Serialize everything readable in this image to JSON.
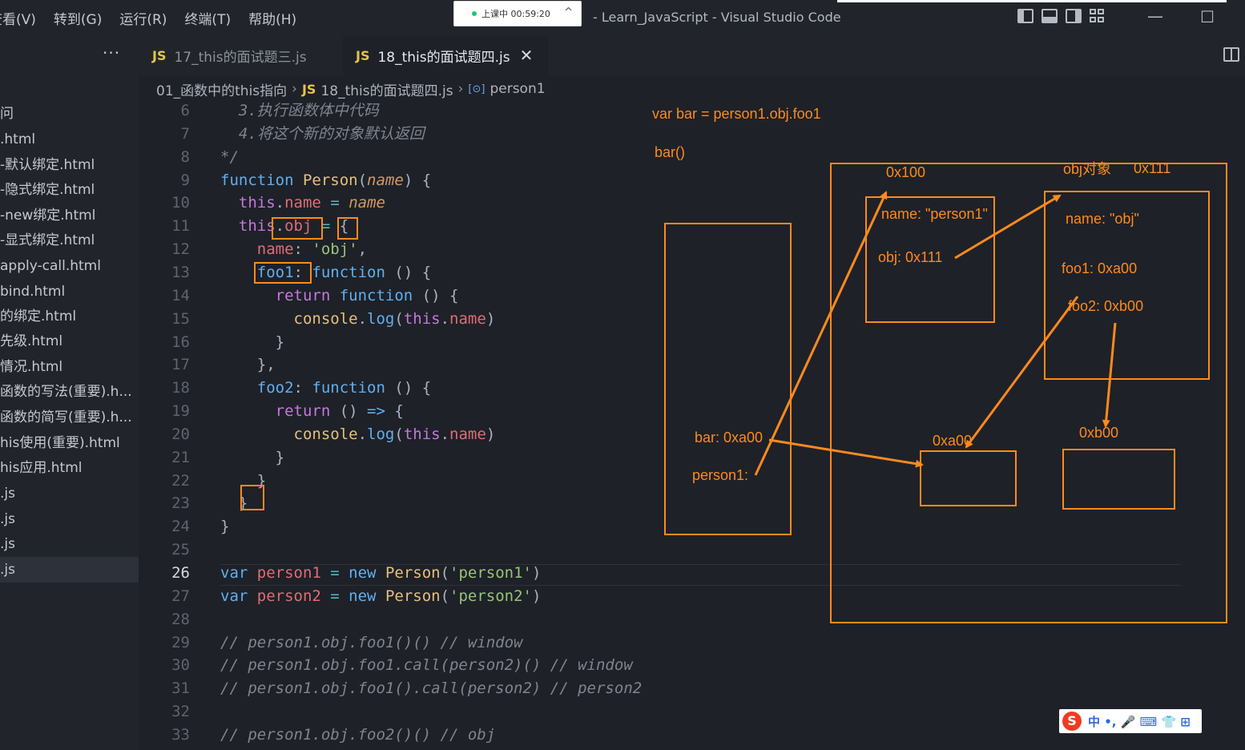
{
  "titlebar": {
    "menu": [
      "查看(V)",
      "转到(G)",
      "运行(R)",
      "终端(T)",
      "帮助(H)"
    ],
    "window_title": "- Learn_JavaScript - Visual Studio Code",
    "recording": "上课中 00:59:20"
  },
  "tabs": {
    "more": "···",
    "inactive": {
      "icon": "JS",
      "label": "17_this的面试题三.js"
    },
    "active": {
      "icon": "JS",
      "label": "18_this的面试题四.js",
      "close": "✕"
    }
  },
  "sidebar": {
    "items": [
      "问",
      ".html",
      "-默认绑定.html",
      "-隐式绑定.html",
      "-new绑定.html",
      "-显式绑定.html",
      "apply-call.html",
      "bind.html",
      "的绑定.html",
      "先级.html",
      "情况.html",
      "函数的写法(重要).h...",
      "函数的简写(重要).h...",
      "his使用(重要).html",
      "his应用.html",
      ".js",
      ".js",
      ".js",
      ".js"
    ]
  },
  "breadcrumb": {
    "folder": "01_函数中的this指向",
    "file_icon": "JS",
    "file": "18_this的面试题四.js",
    "symbol_icon": "[⊙]",
    "symbol": "person1"
  },
  "code": {
    "current_line": 26,
    "lines": [
      {
        "n": "6",
        "tokens": [
          [
            "cm",
            "  3.执行函数体中代码"
          ]
        ]
      },
      {
        "n": "7",
        "tokens": [
          [
            "cm",
            "  4.将这个新的对象默认返回"
          ]
        ]
      },
      {
        "n": "8",
        "tokens": [
          [
            "cm",
            "*/"
          ]
        ]
      },
      {
        "n": "9",
        "tokens": [
          [
            "kwb",
            "function "
          ],
          [
            "fn",
            "Person"
          ],
          [
            "pun",
            "("
          ],
          [
            "par",
            "name"
          ],
          [
            "pun",
            ") {"
          ]
        ]
      },
      {
        "n": "10",
        "tokens": [
          [
            "pun",
            "  "
          ],
          [
            "kw",
            "this"
          ],
          [
            "pun",
            "."
          ],
          [
            "prop",
            "name"
          ],
          [
            "op",
            " = "
          ],
          [
            "par",
            "name"
          ]
        ]
      },
      {
        "n": "11",
        "tokens": [
          [
            "pun",
            "  "
          ],
          [
            "kw",
            "this"
          ],
          [
            "pun",
            "."
          ],
          [
            "prop",
            "obj"
          ],
          [
            "op",
            " = "
          ],
          [
            "pun",
            "{"
          ]
        ]
      },
      {
        "n": "12",
        "tokens": [
          [
            "pun",
            "    "
          ],
          [
            "prop",
            "name"
          ],
          [
            "pun",
            ": "
          ],
          [
            "str",
            "'obj'"
          ],
          [
            "pun",
            ","
          ]
        ]
      },
      {
        "n": "13",
        "tokens": [
          [
            "pun",
            "    "
          ],
          [
            "fnc",
            "foo1"
          ],
          [
            "pun",
            ": "
          ],
          [
            "kwb",
            "function"
          ],
          [
            "pun",
            " () {"
          ]
        ]
      },
      {
        "n": "14",
        "tokens": [
          [
            "pun",
            "      "
          ],
          [
            "kw",
            "return "
          ],
          [
            "kwb",
            "function"
          ],
          [
            "pun",
            " () {"
          ]
        ]
      },
      {
        "n": "15",
        "tokens": [
          [
            "pun",
            "        "
          ],
          [
            "fn",
            "console"
          ],
          [
            "pun",
            "."
          ],
          [
            "fnc",
            "log"
          ],
          [
            "pun",
            "("
          ],
          [
            "kw",
            "this"
          ],
          [
            "pun",
            "."
          ],
          [
            "prop",
            "name"
          ],
          [
            "pun",
            ")"
          ]
        ]
      },
      {
        "n": "16",
        "tokens": [
          [
            "pun",
            "      }"
          ]
        ]
      },
      {
        "n": "17",
        "tokens": [
          [
            "pun",
            "    },"
          ]
        ]
      },
      {
        "n": "18",
        "tokens": [
          [
            "pun",
            "    "
          ],
          [
            "fnc",
            "foo2"
          ],
          [
            "pun",
            ": "
          ],
          [
            "kwb",
            "function"
          ],
          [
            "pun",
            " () {"
          ]
        ]
      },
      {
        "n": "19",
        "tokens": [
          [
            "pun",
            "      "
          ],
          [
            "kw",
            "return"
          ],
          [
            "pun",
            " () "
          ],
          [
            "kwb",
            "=>"
          ],
          [
            "pun",
            " {"
          ]
        ]
      },
      {
        "n": "20",
        "tokens": [
          [
            "pun",
            "        "
          ],
          [
            "fn",
            "console"
          ],
          [
            "pun",
            "."
          ],
          [
            "fnc",
            "log"
          ],
          [
            "pun",
            "("
          ],
          [
            "kw",
            "this"
          ],
          [
            "pun",
            "."
          ],
          [
            "prop",
            "name"
          ],
          [
            "pun",
            ")"
          ]
        ]
      },
      {
        "n": "21",
        "tokens": [
          [
            "pun",
            "      }"
          ]
        ]
      },
      {
        "n": "22",
        "tokens": [
          [
            "pun",
            "    }"
          ]
        ]
      },
      {
        "n": "23",
        "tokens": [
          [
            "pun",
            "  }"
          ]
        ]
      },
      {
        "n": "24",
        "tokens": [
          [
            "pun",
            "}"
          ]
        ]
      },
      {
        "n": "25",
        "tokens": []
      },
      {
        "n": "26",
        "tokens": [
          [
            "kwb",
            "var "
          ],
          [
            "prop",
            "person1"
          ],
          [
            "op",
            " = "
          ],
          [
            "kwb",
            "new "
          ],
          [
            "fn",
            "Person"
          ],
          [
            "pun",
            "("
          ],
          [
            "str",
            "'person1'"
          ],
          [
            "pun",
            ")"
          ]
        ]
      },
      {
        "n": "27",
        "tokens": [
          [
            "kwb",
            "var "
          ],
          [
            "prop",
            "person2"
          ],
          [
            "op",
            " = "
          ],
          [
            "kwb",
            "new "
          ],
          [
            "fn",
            "Person"
          ],
          [
            "pun",
            "("
          ],
          [
            "str",
            "'person2'"
          ],
          [
            "pun",
            ")"
          ]
        ]
      },
      {
        "n": "28",
        "tokens": []
      },
      {
        "n": "29",
        "tokens": [
          [
            "cm",
            "// person1.obj.foo1()() // window"
          ]
        ]
      },
      {
        "n": "30",
        "tokens": [
          [
            "cm",
            "// person1.obj.foo1.call(person2)() // window"
          ]
        ]
      },
      {
        "n": "31",
        "tokens": [
          [
            "cm",
            "// person1.obj.foo1().call(person2) // person2"
          ]
        ]
      },
      {
        "n": "32",
        "tokens": []
      },
      {
        "n": "33",
        "tokens": [
          [
            "cm",
            "// person1.obj.foo2()() // obj"
          ]
        ]
      }
    ]
  },
  "annotations": {
    "var_bar": "var bar = person1.obj.foo1",
    "bar_call": "bar()",
    "addr_0x100": "0x100",
    "obj_label": "obj对象",
    "addr_0x111": "0x111",
    "p_name": "name: \"person1\"",
    "p_obj": "obj: 0x111",
    "o_name": "name: \"obj\"",
    "o_foo1": "foo1: 0xa00",
    "o_foo2": "foo2: 0xb00",
    "bar_ref": "bar: 0xa00",
    "person1_ref": "person1:",
    "addr_0xa00": "0xa00",
    "addr_0xb00": "0xb00",
    "color": "#ff8a1d"
  },
  "ime": {
    "logo": "S",
    "text": "中 •, 🎤 ⌨ 👕 ⊞"
  }
}
